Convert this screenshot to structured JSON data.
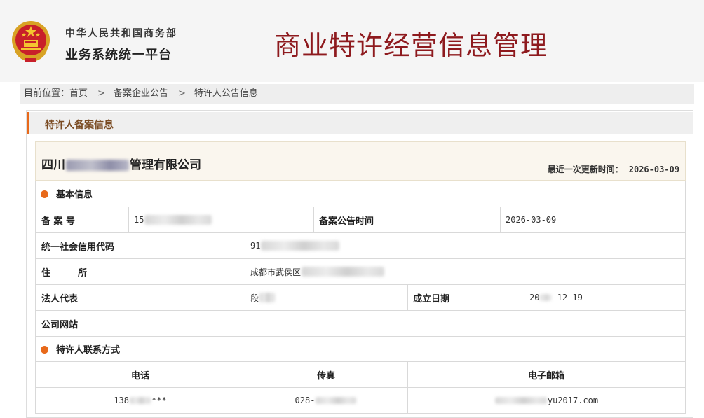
{
  "header": {
    "org_line1": "中华人民共和国商务部",
    "org_line2": "业务系统统一平台",
    "site_title": "商业特许经营信息管理"
  },
  "breadcrumb": {
    "prefix": "目前位置：",
    "items": [
      "首页",
      "备案企业公告",
      "特许人公告信息"
    ]
  },
  "panel": {
    "heading": "特许人备案信息",
    "company_name_prefix": "四川",
    "company_name_suffix": "管理有限公司",
    "update_label": "最近一次更新时间：",
    "update_value": "2026-03-09"
  },
  "basic_info": {
    "section_title": "基本信息",
    "record_no_label": "备 案 号",
    "record_no_value": "15",
    "announce_time_label": "备案公告时间",
    "announce_time_value": "2026-03-09",
    "credit_code_label": "统一社会信用代码",
    "credit_code_value": "91",
    "address_label": "住　　　所",
    "address_value": "成都市武侯区",
    "legal_rep_label": "法人代表",
    "legal_rep_value": "段",
    "established_label": "成立日期",
    "established_prefix": "20",
    "established_suffix": "-12-19",
    "website_label": "公司网站",
    "website_value": ""
  },
  "contact": {
    "section_title": "特许人联系方式",
    "headers": [
      "电话",
      "传真",
      "电子邮箱"
    ],
    "phone_prefix": "138",
    "phone_suffix": "***",
    "fax_prefix": "028-",
    "email_suffix": "yu2017.com"
  },
  "colors": {
    "title_red": "#8e1a1e",
    "accent_orange": "#e8691a",
    "panel_heading_brown": "#7a4b22"
  }
}
